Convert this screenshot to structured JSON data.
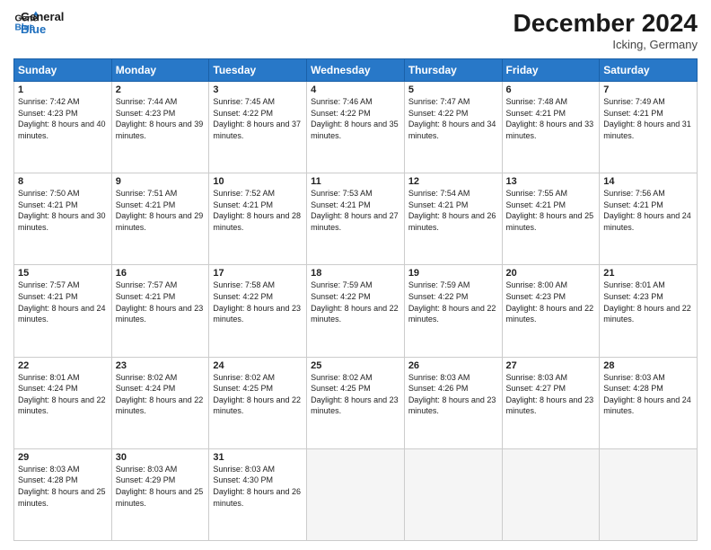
{
  "header": {
    "logo_line1": "General",
    "logo_line2": "Blue",
    "month_title": "December 2024",
    "location": "Icking, Germany"
  },
  "days_of_week": [
    "Sunday",
    "Monday",
    "Tuesday",
    "Wednesday",
    "Thursday",
    "Friday",
    "Saturday"
  ],
  "weeks": [
    [
      {
        "day": "1",
        "sunrise": "Sunrise: 7:42 AM",
        "sunset": "Sunset: 4:23 PM",
        "daylight": "Daylight: 8 hours and 40 minutes."
      },
      {
        "day": "2",
        "sunrise": "Sunrise: 7:44 AM",
        "sunset": "Sunset: 4:23 PM",
        "daylight": "Daylight: 8 hours and 39 minutes."
      },
      {
        "day": "3",
        "sunrise": "Sunrise: 7:45 AM",
        "sunset": "Sunset: 4:22 PM",
        "daylight": "Daylight: 8 hours and 37 minutes."
      },
      {
        "day": "4",
        "sunrise": "Sunrise: 7:46 AM",
        "sunset": "Sunset: 4:22 PM",
        "daylight": "Daylight: 8 hours and 35 minutes."
      },
      {
        "day": "5",
        "sunrise": "Sunrise: 7:47 AM",
        "sunset": "Sunset: 4:22 PM",
        "daylight": "Daylight: 8 hours and 34 minutes."
      },
      {
        "day": "6",
        "sunrise": "Sunrise: 7:48 AM",
        "sunset": "Sunset: 4:21 PM",
        "daylight": "Daylight: 8 hours and 33 minutes."
      },
      {
        "day": "7",
        "sunrise": "Sunrise: 7:49 AM",
        "sunset": "Sunset: 4:21 PM",
        "daylight": "Daylight: 8 hours and 31 minutes."
      }
    ],
    [
      {
        "day": "8",
        "sunrise": "Sunrise: 7:50 AM",
        "sunset": "Sunset: 4:21 PM",
        "daylight": "Daylight: 8 hours and 30 minutes."
      },
      {
        "day": "9",
        "sunrise": "Sunrise: 7:51 AM",
        "sunset": "Sunset: 4:21 PM",
        "daylight": "Daylight: 8 hours and 29 minutes."
      },
      {
        "day": "10",
        "sunrise": "Sunrise: 7:52 AM",
        "sunset": "Sunset: 4:21 PM",
        "daylight": "Daylight: 8 hours and 28 minutes."
      },
      {
        "day": "11",
        "sunrise": "Sunrise: 7:53 AM",
        "sunset": "Sunset: 4:21 PM",
        "daylight": "Daylight: 8 hours and 27 minutes."
      },
      {
        "day": "12",
        "sunrise": "Sunrise: 7:54 AM",
        "sunset": "Sunset: 4:21 PM",
        "daylight": "Daylight: 8 hours and 26 minutes."
      },
      {
        "day": "13",
        "sunrise": "Sunrise: 7:55 AM",
        "sunset": "Sunset: 4:21 PM",
        "daylight": "Daylight: 8 hours and 25 minutes."
      },
      {
        "day": "14",
        "sunrise": "Sunrise: 7:56 AM",
        "sunset": "Sunset: 4:21 PM",
        "daylight": "Daylight: 8 hours and 24 minutes."
      }
    ],
    [
      {
        "day": "15",
        "sunrise": "Sunrise: 7:57 AM",
        "sunset": "Sunset: 4:21 PM",
        "daylight": "Daylight: 8 hours and 24 minutes."
      },
      {
        "day": "16",
        "sunrise": "Sunrise: 7:57 AM",
        "sunset": "Sunset: 4:21 PM",
        "daylight": "Daylight: 8 hours and 23 minutes."
      },
      {
        "day": "17",
        "sunrise": "Sunrise: 7:58 AM",
        "sunset": "Sunset: 4:22 PM",
        "daylight": "Daylight: 8 hours and 23 minutes."
      },
      {
        "day": "18",
        "sunrise": "Sunrise: 7:59 AM",
        "sunset": "Sunset: 4:22 PM",
        "daylight": "Daylight: 8 hours and 22 minutes."
      },
      {
        "day": "19",
        "sunrise": "Sunrise: 7:59 AM",
        "sunset": "Sunset: 4:22 PM",
        "daylight": "Daylight: 8 hours and 22 minutes."
      },
      {
        "day": "20",
        "sunrise": "Sunrise: 8:00 AM",
        "sunset": "Sunset: 4:23 PM",
        "daylight": "Daylight: 8 hours and 22 minutes."
      },
      {
        "day": "21",
        "sunrise": "Sunrise: 8:01 AM",
        "sunset": "Sunset: 4:23 PM",
        "daylight": "Daylight: 8 hours and 22 minutes."
      }
    ],
    [
      {
        "day": "22",
        "sunrise": "Sunrise: 8:01 AM",
        "sunset": "Sunset: 4:24 PM",
        "daylight": "Daylight: 8 hours and 22 minutes."
      },
      {
        "day": "23",
        "sunrise": "Sunrise: 8:02 AM",
        "sunset": "Sunset: 4:24 PM",
        "daylight": "Daylight: 8 hours and 22 minutes."
      },
      {
        "day": "24",
        "sunrise": "Sunrise: 8:02 AM",
        "sunset": "Sunset: 4:25 PM",
        "daylight": "Daylight: 8 hours and 22 minutes."
      },
      {
        "day": "25",
        "sunrise": "Sunrise: 8:02 AM",
        "sunset": "Sunset: 4:25 PM",
        "daylight": "Daylight: 8 hours and 23 minutes."
      },
      {
        "day": "26",
        "sunrise": "Sunrise: 8:03 AM",
        "sunset": "Sunset: 4:26 PM",
        "daylight": "Daylight: 8 hours and 23 minutes."
      },
      {
        "day": "27",
        "sunrise": "Sunrise: 8:03 AM",
        "sunset": "Sunset: 4:27 PM",
        "daylight": "Daylight: 8 hours and 23 minutes."
      },
      {
        "day": "28",
        "sunrise": "Sunrise: 8:03 AM",
        "sunset": "Sunset: 4:28 PM",
        "daylight": "Daylight: 8 hours and 24 minutes."
      }
    ],
    [
      {
        "day": "29",
        "sunrise": "Sunrise: 8:03 AM",
        "sunset": "Sunset: 4:28 PM",
        "daylight": "Daylight: 8 hours and 25 minutes."
      },
      {
        "day": "30",
        "sunrise": "Sunrise: 8:03 AM",
        "sunset": "Sunset: 4:29 PM",
        "daylight": "Daylight: 8 hours and 25 minutes."
      },
      {
        "day": "31",
        "sunrise": "Sunrise: 8:03 AM",
        "sunset": "Sunset: 4:30 PM",
        "daylight": "Daylight: 8 hours and 26 minutes."
      },
      null,
      null,
      null,
      null
    ]
  ]
}
